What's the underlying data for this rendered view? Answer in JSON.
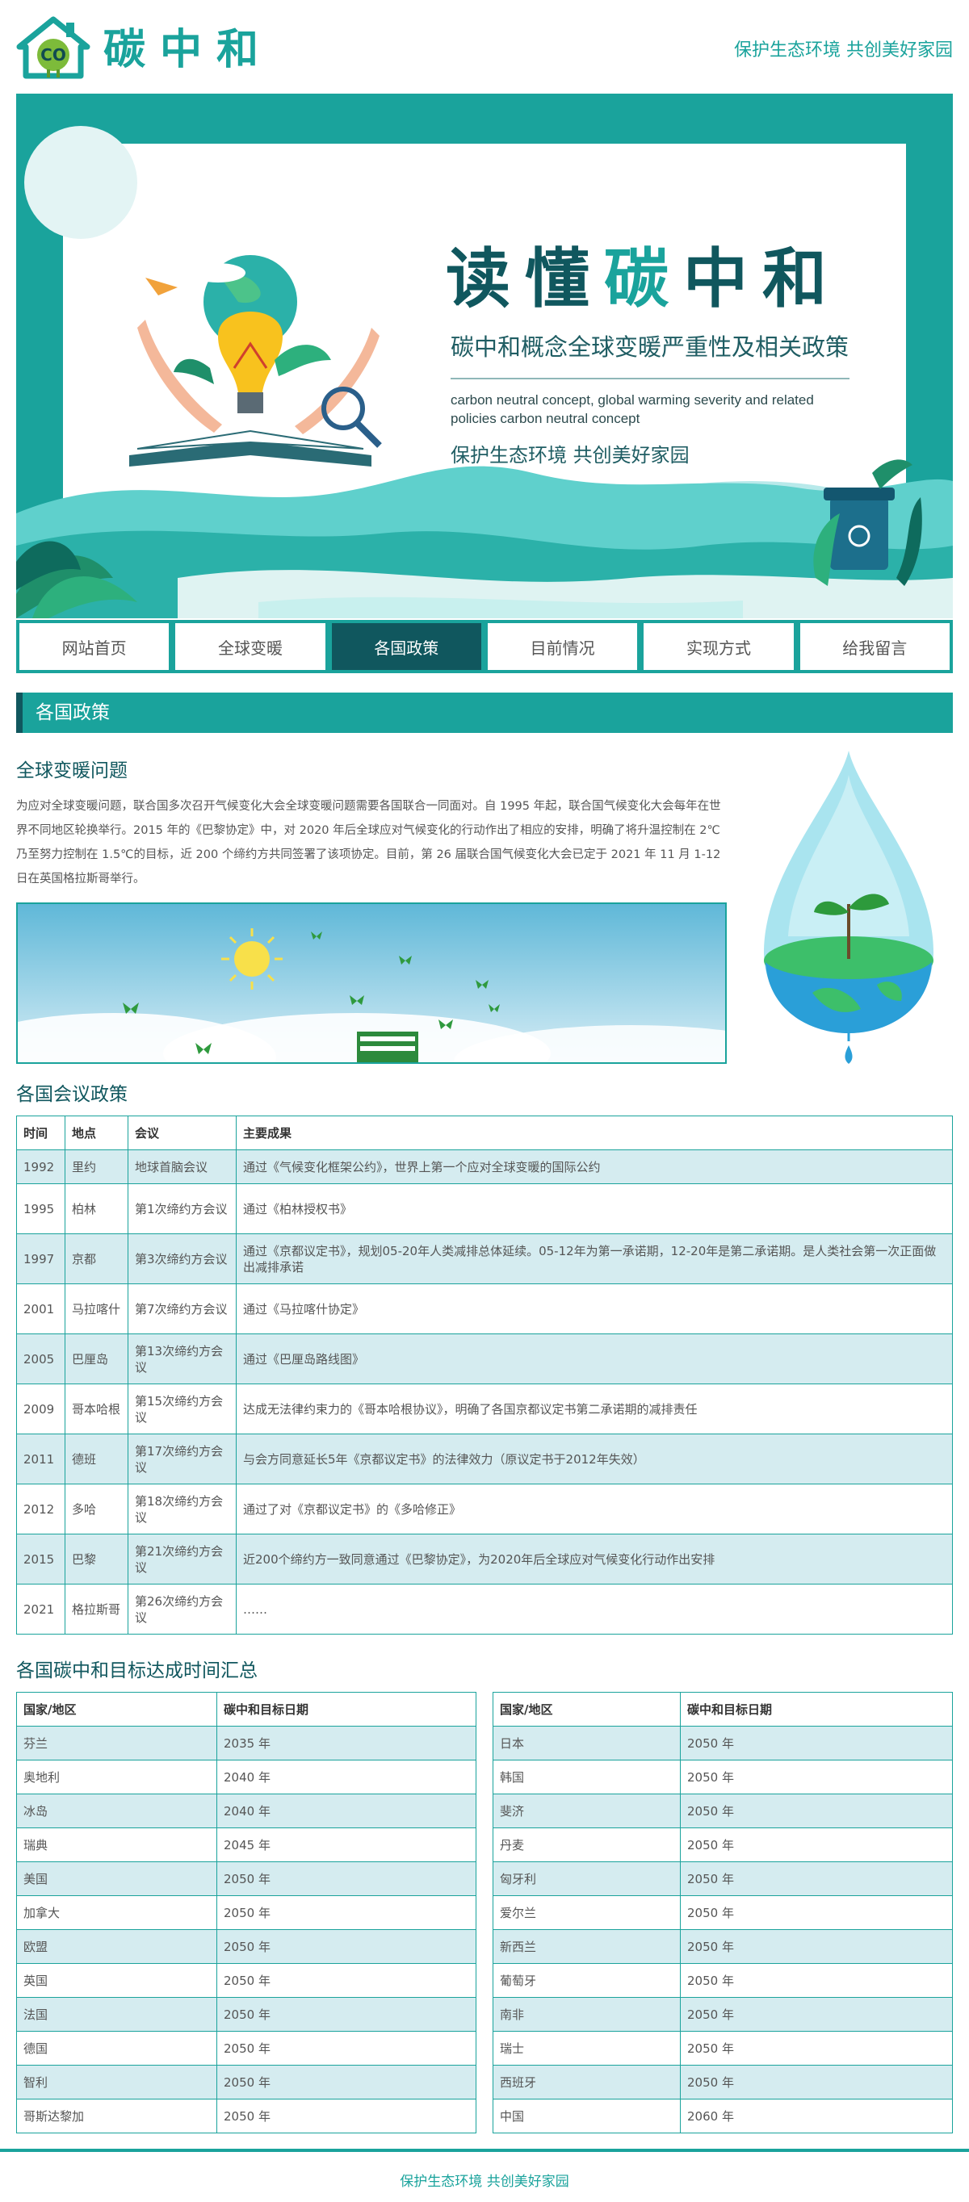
{
  "header": {
    "logo_text": "碳中和",
    "logo_badge": "CO",
    "slogan": "保护生态环境  共创美好家园"
  },
  "banner": {
    "title_pre": "读懂",
    "title_hl": "碳",
    "title_post": "中和",
    "subtitle": "碳中和概念全球变暖严重性及相关政策",
    "english": "carbon neutral concept, global warming severity and related policies carbon neutral concept",
    "slogan": "保护生态环境    共创美好家园"
  },
  "nav": {
    "items": [
      "网站首页",
      "全球变暖",
      "各国政策",
      "目前情况",
      "实现方式",
      "给我留言"
    ],
    "active_index": 2
  },
  "section": {
    "title": "各国政策"
  },
  "warming": {
    "heading": "全球变暖问题",
    "text": "为应对全球变暖问题，联合国多次召开气候变化大会全球变暖问题需要各国联合一同面对。自 1995 年起，联合国气候变化大会每年在世界不同地区轮换举行。2015 年的《巴黎协定》中，对 2020 年后全球应对气候变化的行动作出了相应的安排，明确了将升温控制在 2℃乃至努力控制在 1.5℃的目标，近 200 个缔约方共同签署了该项协定。目前，第 26 届联合国气候变化大会已定于 2021 年 11 月 1-12 日在英国格拉斯哥举行。"
  },
  "conferences": {
    "heading": "各国会议政策",
    "headers": [
      "时间",
      "地点",
      "会议",
      "主要成果"
    ],
    "rows": [
      [
        "1992",
        "里约",
        "地球首脑会议",
        "通过《气候变化框架公约》，世界上第一个应对全球变暖的国际公约"
      ],
      [
        "1995",
        "柏林",
        "第1次缔约方会议",
        "通过《柏林授权书》"
      ],
      [
        "1997",
        "京都",
        "第3次缔约方会议",
        "通过《京都议定书》，规划05-20年人类减排总体延续。05-12年为第一承诺期，12-20年是第二承诺期。是人类社会第一次正面做出减排承诺"
      ],
      [
        "2001",
        "马拉喀什",
        "第7次缔约方会议",
        "通过《马拉喀什协定》"
      ],
      [
        "2005",
        "巴厘岛",
        "第13次缔约方会议",
        "通过《巴厘岛路线图》"
      ],
      [
        "2009",
        "哥本哈根",
        "第15次缔约方会议",
        "达成无法律约束力的《哥本哈根协议》，明确了各国京都议定书第二承诺期的减排责任"
      ],
      [
        "2011",
        "德班",
        "第17次缔约方会议",
        "与会方同意延长5年《京都议定书》的法律效力（原议定书于2012年失效）"
      ],
      [
        "2012",
        "多哈",
        "第18次缔约方会议",
        "通过了对《京都议定书》的《多哈修正》"
      ],
      [
        "2015",
        "巴黎",
        "第21次缔约方会议",
        "近200个缔约方一致同意通过《巴黎协定》，为2020年后全球应对气候变化行动作出安排"
      ],
      [
        "2021",
        "格拉斯哥",
        "第26次缔约方会议",
        "……"
      ]
    ]
  },
  "targets": {
    "heading": "各国碳中和目标达成时间汇总",
    "headers": [
      "国家/地区",
      "碳中和目标日期"
    ],
    "left": [
      [
        "芬兰",
        "2035 年"
      ],
      [
        "奥地利",
        "2040 年"
      ],
      [
        "冰岛",
        "2040 年"
      ],
      [
        "瑞典",
        "2045 年"
      ],
      [
        "美国",
        "2050 年"
      ],
      [
        "加拿大",
        "2050 年"
      ],
      [
        "欧盟",
        "2050 年"
      ],
      [
        "英国",
        "2050 年"
      ],
      [
        "法国",
        "2050 年"
      ],
      [
        "德国",
        "2050 年"
      ],
      [
        "智利",
        "2050 年"
      ],
      [
        "哥斯达黎加",
        "2050 年"
      ]
    ],
    "right": [
      [
        "日本",
        "2050 年"
      ],
      [
        "韩国",
        "2050 年"
      ],
      [
        "斐济",
        "2050 年"
      ],
      [
        "丹麦",
        "2050 年"
      ],
      [
        "匈牙利",
        "2050 年"
      ],
      [
        "爱尔兰",
        "2050 年"
      ],
      [
        "新西兰",
        "2050 年"
      ],
      [
        "葡萄牙",
        "2050 年"
      ],
      [
        "南非",
        "2050 年"
      ],
      [
        "瑞士",
        "2050 年"
      ],
      [
        "西班牙",
        "2050 年"
      ],
      [
        "中国",
        "2060 年"
      ]
    ]
  },
  "footer": {
    "text": "保护生态环境  共创美好家园"
  },
  "colors": {
    "accent": "#1aa39c",
    "dark": "#10575e",
    "row_alt": "#d5ecf0"
  }
}
